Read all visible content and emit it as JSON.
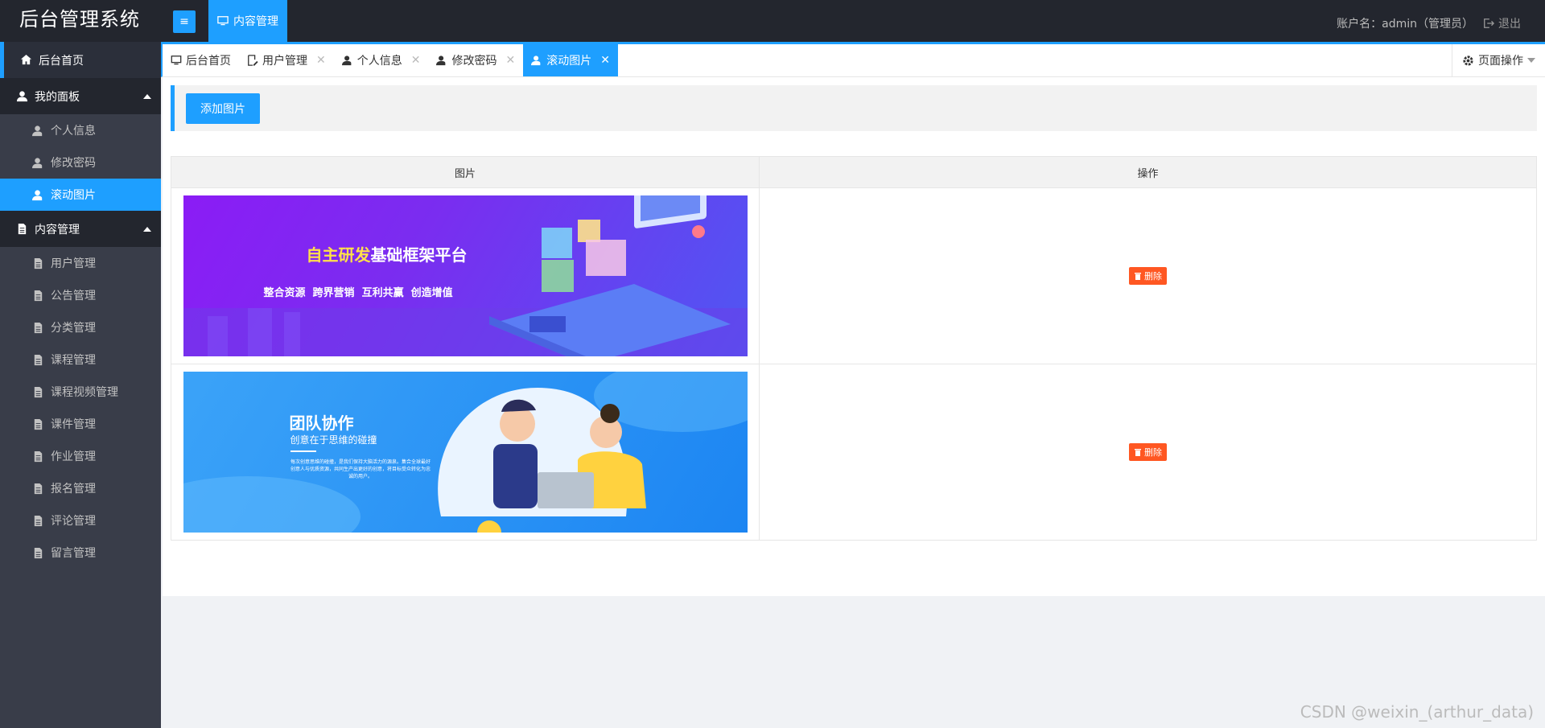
{
  "header": {
    "app_title": "后台管理系统",
    "menu_toggle_icon": "hamburger-icon",
    "top_nav_label": "内容管理",
    "account_label": "账户名：admin（管理员）",
    "logout_label": "退出"
  },
  "sidebar": {
    "home_label": "后台首页",
    "panel_group": "我的面板",
    "panel_items": [
      "个人信息",
      "修改密码",
      "滚动图片"
    ],
    "content_group": "内容管理",
    "content_items": [
      "用户管理",
      "公告管理",
      "分类管理",
      "课程管理",
      "课程视频管理",
      "课件管理",
      "作业管理",
      "报名管理",
      "评论管理",
      "留言管理"
    ]
  },
  "tabs": [
    {
      "label": "后台首页",
      "active": false,
      "closable": false
    },
    {
      "label": "用户管理",
      "active": false,
      "closable": true
    },
    {
      "label": "个人信息",
      "active": false,
      "closable": true
    },
    {
      "label": "修改密码",
      "active": false,
      "closable": true
    },
    {
      "label": "滚动图片",
      "active": true,
      "closable": true
    }
  ],
  "page_ops_label": "页面操作",
  "toolbar": {
    "add_label": "添加图片"
  },
  "table": {
    "headers": [
      "图片",
      "操作"
    ],
    "delete_label": "删除"
  },
  "banners": [
    {
      "title_highlight": "自主研发",
      "title_rest": "基础框架平台",
      "subtitle": "整合资源  跨界营销  互利共赢  创造增值"
    },
    {
      "title": "团队协作",
      "subtitle": "创意在于思维的碰撞",
      "small_text": "每次创意思维的碰撞，是我们保持大脑活力的源泉。集合全球最好创意人与优质资源，共同生产出更好的创意，将目标受众转化为忠诚的用户。"
    }
  ],
  "watermark": "CSDN @weixin_(arthur_data)",
  "colors": {
    "accent": "#1e9fff",
    "danger": "#ff5722",
    "header_bg": "#23262e",
    "sidebar_bg": "#393d49"
  }
}
